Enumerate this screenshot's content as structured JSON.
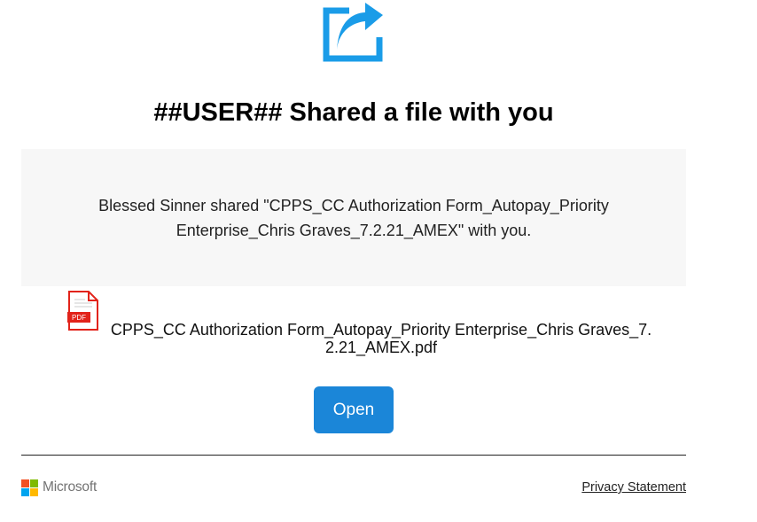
{
  "header": {
    "icon": "share-icon",
    "title": "##USER## Shared a file with you"
  },
  "message": {
    "text": "Blessed Sinner shared \"CPPS_CC Authorization Form_Autopay_Priority Enterprise_Chris Graves_7.2.21_AMEX\" with you."
  },
  "file": {
    "icon": "pdf-file-icon",
    "icon_label": "PDF",
    "name": "CPPS_CC Authorization Form_Autopay_Priority Enterprise_Chris Graves_7.2.21_AMEX.pdf"
  },
  "actions": {
    "open_label": "Open"
  },
  "footer": {
    "brand": "Microsoft",
    "privacy_label": "Privacy Statement"
  },
  "colors": {
    "accent": "#1b86d8",
    "share_icon": "#1a9ce8",
    "pdf_red": "#e2231a",
    "message_bg": "#f7f7f7",
    "ms_red": "#f25022",
    "ms_green": "#7fba00",
    "ms_blue": "#00a4ef",
    "ms_yellow": "#ffb900"
  }
}
